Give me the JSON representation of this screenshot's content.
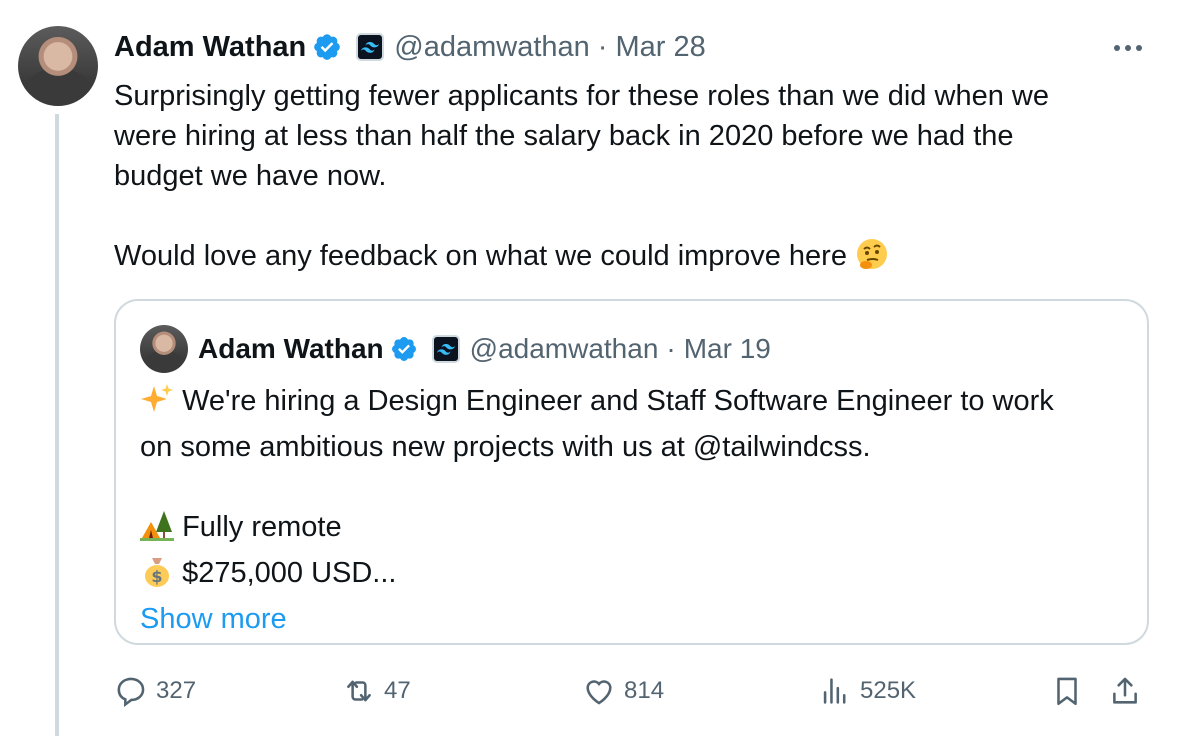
{
  "tweet": {
    "author_name": "Adam Wathan",
    "handle": "@adamwathan",
    "separator": "·",
    "time": "Mar 28",
    "body_lines": [
      "Surprisingly getting fewer applicants for these roles than we did when we",
      "were hiring at less than half the salary back in 2020 before we had the",
      "budget we have now."
    ],
    "body_line4": "Would love any feedback on what we could improve here"
  },
  "quote": {
    "author_name": "Adam Wathan",
    "handle": "@adamwathan",
    "separator": "·",
    "time": "Mar 19",
    "line1": "We're hiring a Design Engineer and Staff Software Engineer to work",
    "line2": "on some ambitious new projects with us at @tailwindcss.",
    "line3": "Fully remote",
    "line4": "$275,000 USD...",
    "show_more": "Show more"
  },
  "actions": {
    "replies": "327",
    "reposts": "47",
    "likes": "814",
    "views": "525K"
  },
  "colors": {
    "accent": "#1d9bf0",
    "muted": "#536471",
    "border": "#cfd9de"
  }
}
